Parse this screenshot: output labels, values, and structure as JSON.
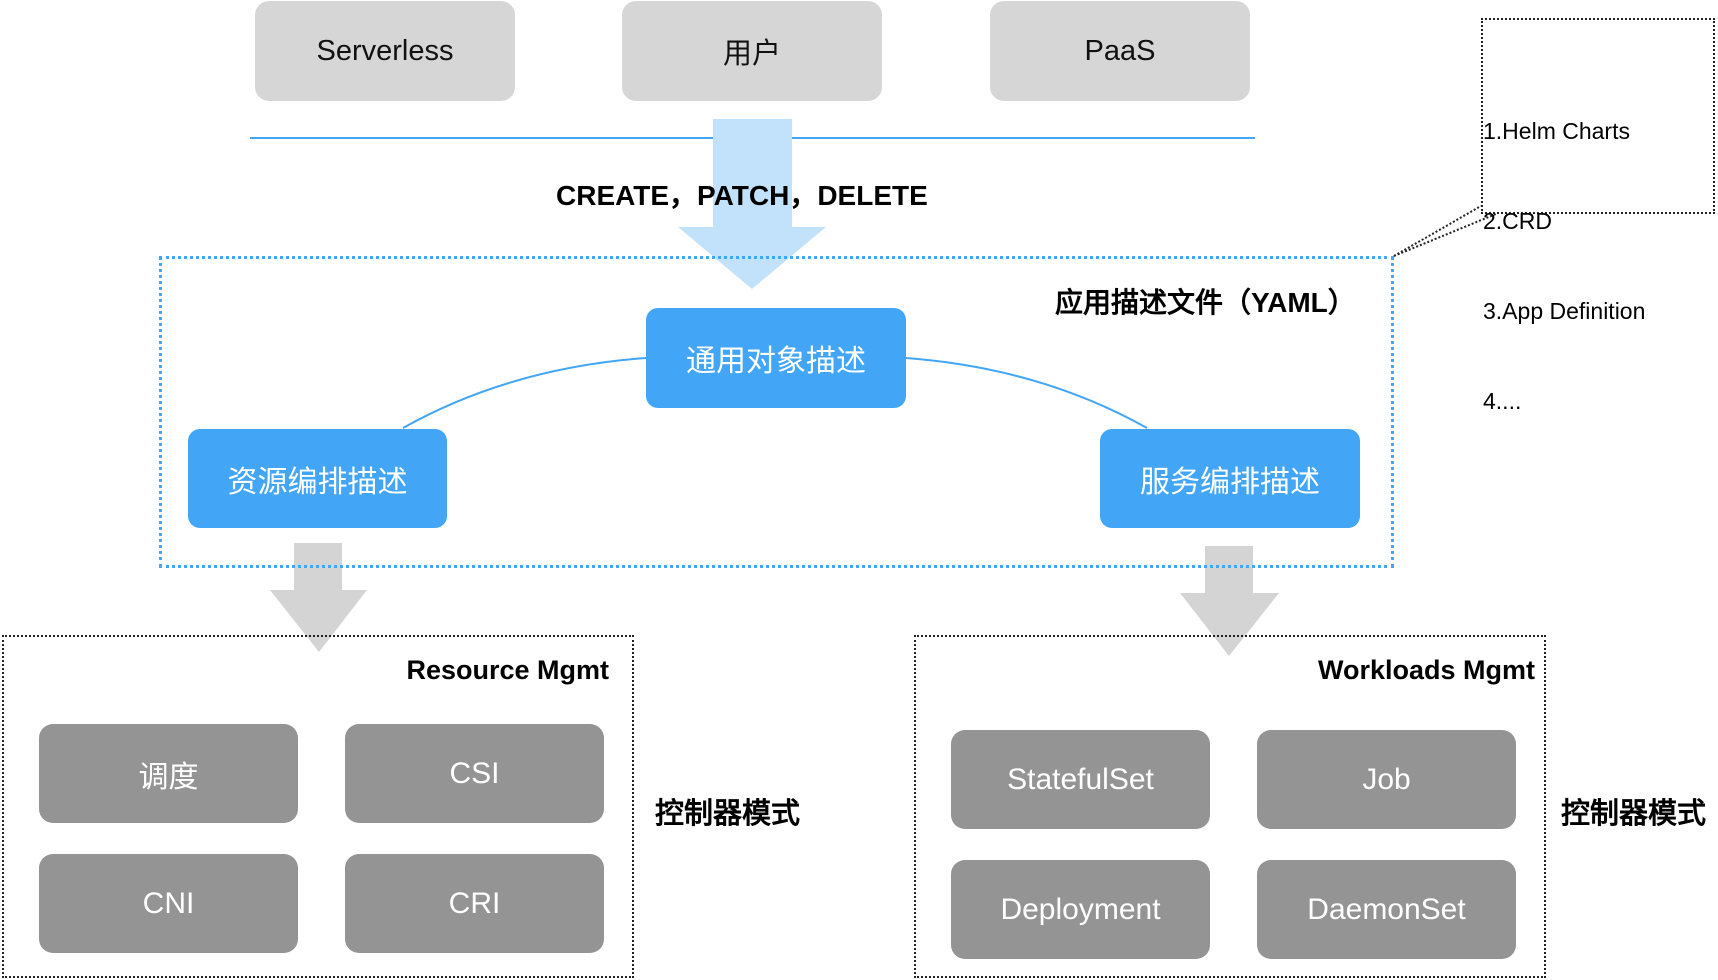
{
  "top_sources": [
    {
      "label": "Serverless"
    },
    {
      "label": "用户"
    },
    {
      "label": "PaaS"
    }
  ],
  "api_operations_label": "CREATE，PATCH，DELETE",
  "callout": {
    "lines": [
      "1.Helm Charts",
      "2.CRD",
      "3.App Definition",
      "4...."
    ]
  },
  "app_description": {
    "title": "应用描述文件（YAML）",
    "center_node": "通用对象描述",
    "left_node": "资源编排描述",
    "right_node": "服务编排描述"
  },
  "resource_mgmt": {
    "title": "Resource Mgmt",
    "items": [
      {
        "label": "调度"
      },
      {
        "label": "CSI"
      },
      {
        "label": "CNI"
      },
      {
        "label": "CRI"
      }
    ],
    "side_label": "控制器模式"
  },
  "workloads_mgmt": {
    "title": "Workloads Mgmt",
    "items": [
      {
        "label": "StatefulSet"
      },
      {
        "label": "Job"
      },
      {
        "label": "Deployment"
      },
      {
        "label": "DaemonSet"
      }
    ],
    "side_label": "控制器模式"
  },
  "colors": {
    "accent_blue": "#42a5f5",
    "light_blue_arrow": "#c2e2fb",
    "grey_arrow": "#d4d4d4",
    "source_box": "#d6d6d6",
    "component_box": "#949494"
  }
}
